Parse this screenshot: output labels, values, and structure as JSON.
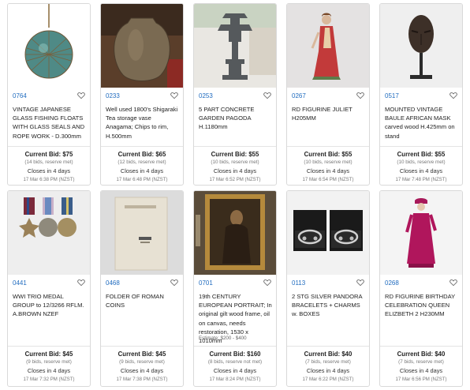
{
  "lots": [
    {
      "lot": "0764",
      "title": "VINTAGE JAPANESE GLASS FISHING FLOATS WITH GLASS SEALS AND ROPE WORK - D.300mm",
      "estimate": "",
      "current_bid": "Current Bid: $75",
      "bids": "(14 bids, reserve met)",
      "closes": "Closes in 4 days",
      "close_time": "17 Mar 6:38 PM (NZST)",
      "image": "glass-fishing-float"
    },
    {
      "lot": "0233",
      "title": "Well used 1800's Shigaraki Tea storage vase Anagama; Chips to rim, H.500mm",
      "estimate": "",
      "current_bid": "Current Bid: $65",
      "bids": "(12 bids, reserve met)",
      "closes": "Closes in 4 days",
      "close_time": "17 Mar 6:48 PM (NZST)",
      "image": "ceramic-jar"
    },
    {
      "lot": "0253",
      "title": "5 PART CONCRETE GARDEN PAGODA H.1180mm",
      "estimate": "",
      "current_bid": "Current Bid: $55",
      "bids": "(10 bids, reserve met)",
      "closes": "Closes in 4 days",
      "close_time": "17 Mar 6:52 PM (NZST)",
      "image": "garden-pagoda"
    },
    {
      "lot": "0267",
      "title": "RD FIGURINE JULIET H205MM",
      "estimate": "",
      "current_bid": "Current Bid: $55",
      "bids": "(10 bids, reserve met)",
      "closes": "Closes in 4 days",
      "close_time": "17 Mar 6:54 PM (NZST)",
      "image": "figurine-juliet"
    },
    {
      "lot": "0517",
      "title": "MOUNTED VINTAGE BAULE AFRICAN MASK carved wood H.425mm on stand",
      "estimate": "",
      "current_bid": "Current Bid: $55",
      "bids": "(10 bids, reserve met)",
      "closes": "Closes in 4 days",
      "close_time": "17 Mar 7:48 PM (NZST)",
      "image": "african-mask"
    },
    {
      "lot": "0441",
      "title": "WWI TRIO MEDAL GROUP to 12/3266 RFLM. A.BROWN NZEF",
      "estimate": "",
      "current_bid": "Current Bid: $45",
      "bids": "(9 bids, reserve met)",
      "closes": "Closes in 4 days",
      "close_time": "17 Mar 7:32 PM (NZST)",
      "image": "medal-group"
    },
    {
      "lot": "0468",
      "title": "FOLDER OF ROMAN COINS",
      "estimate": "",
      "current_bid": "Current Bid: $45",
      "bids": "(9 bids, reserve met)",
      "closes": "Closes in 4 days",
      "close_time": "17 Mar 7:38 PM (NZST)",
      "image": "coin-folder"
    },
    {
      "lot": "0701",
      "title": "19th CENTURY EUROPEAN PORTRAIT; In original gilt wood frame, oil on canvas, needs restoration, 1530 x 1010mm",
      "estimate": "Estimate: $200 - $400",
      "current_bid": "Current Bid: $160",
      "bids": "(8 bids, reserve not met)",
      "closes": "Closes in 4 days",
      "close_time": "17 Mar 8:24 PM (NZST)",
      "image": "framed-portrait"
    },
    {
      "lot": "0113",
      "title": "2 STG SILVER PANDORA BRACELETS + CHARMS w. BOXES",
      "estimate": "",
      "current_bid": "Current Bid: $40",
      "bids": "(7 bids, reserve met)",
      "closes": "Closes in 4 days",
      "close_time": "17 Mar 6:22 PM (NZST)",
      "image": "bracelets"
    },
    {
      "lot": "0268",
      "title": "RD FIGURINE BIRTHDAY CELEBRATION QUEEN ELIZBETH 2 H230MM",
      "estimate": "",
      "current_bid": "Current Bid: $40",
      "bids": "(7 bids, reserve met)",
      "closes": "Closes in 4 days",
      "close_time": "17 Mar 6:56 PM (NZST)",
      "image": "figurine-queen"
    }
  ],
  "colors": {
    "lot_link": "#1f6bbf",
    "border": "#d9d9d9"
  }
}
